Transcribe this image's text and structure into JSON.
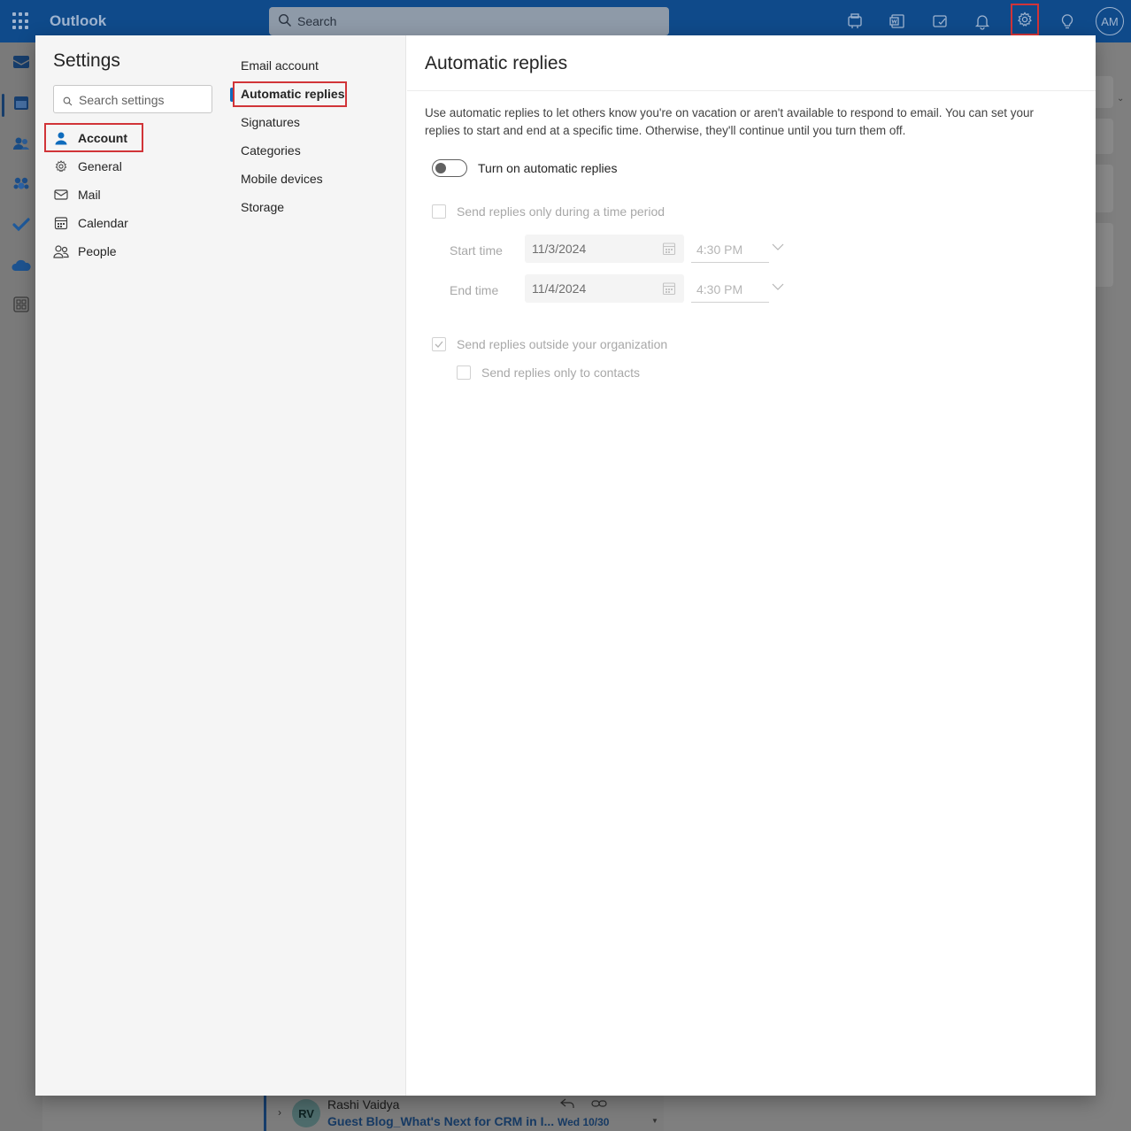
{
  "app": {
    "name": "Outlook",
    "search_placeholder": "Search",
    "user_initials": "AM"
  },
  "topbar_icons": [
    "meet-now-icon",
    "word-icon",
    "my-day-icon",
    "bell-icon",
    "gear-icon",
    "lightbulb-icon"
  ],
  "rail_icons": [
    "mail-icon",
    "calendar-icon",
    "people-icon",
    "groups-icon",
    "todo-icon",
    "onedrive-icon",
    "apps-icon"
  ],
  "settings": {
    "title": "Settings",
    "search_placeholder": "Search settings",
    "categories": [
      {
        "label": "Account",
        "icon": "person-icon",
        "selected": true
      },
      {
        "label": "General",
        "icon": "gear-icon",
        "selected": false
      },
      {
        "label": "Mail",
        "icon": "mail-icon",
        "selected": false
      },
      {
        "label": "Calendar",
        "icon": "calendar-icon",
        "selected": false
      },
      {
        "label": "People",
        "icon": "people-icon",
        "selected": false
      }
    ],
    "subcategories": [
      {
        "label": "Email account",
        "selected": false
      },
      {
        "label": "Automatic replies",
        "selected": true
      },
      {
        "label": "Signatures",
        "selected": false
      },
      {
        "label": "Categories",
        "selected": false
      },
      {
        "label": "Mobile devices",
        "selected": false
      },
      {
        "label": "Storage",
        "selected": false
      }
    ]
  },
  "automatic_replies": {
    "title": "Automatic replies",
    "description": "Use automatic replies to let others know you're on vacation or aren't available to respond to email. You can set your replies to start and end at a specific time. Otherwise, they'll continue until you turn them off.",
    "toggle_label": "Turn on automatic replies",
    "toggle_on": false,
    "time_period_label": "Send replies only during a time period",
    "time_period_checked": false,
    "start_label": "Start time",
    "start_date": "11/3/2024",
    "start_time": "4:30 PM",
    "end_label": "End time",
    "end_date": "11/4/2024",
    "end_time": "4:30 PM",
    "outside_org_label": "Send replies outside your organization",
    "outside_org_checked": true,
    "contacts_only_label": "Send replies only to contacts",
    "contacts_only_checked": false
  },
  "background_message": {
    "initials": "RV",
    "sender": "Rashi Vaidya",
    "subject": "Guest Blog_What's Next for CRM in I...",
    "date": "Wed 10/30"
  },
  "colors": {
    "header": "#0f4a8a",
    "accent": "#0f6cbd",
    "highlight_box": "#d13438"
  }
}
